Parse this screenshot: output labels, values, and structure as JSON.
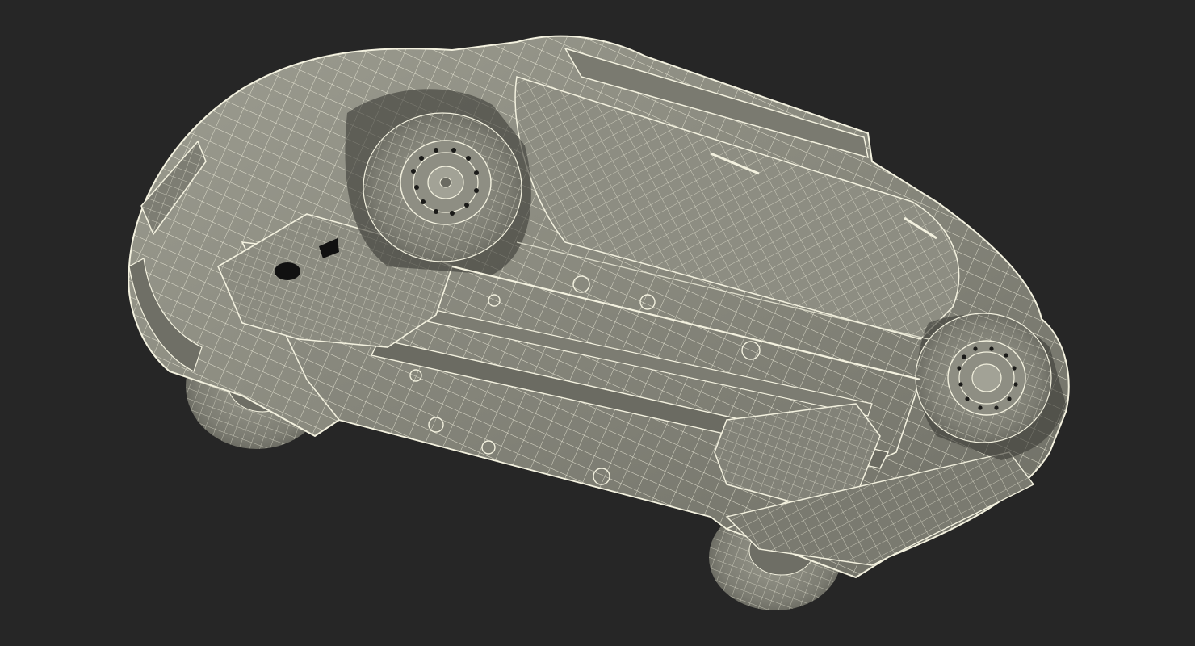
{
  "scene": {
    "subject": "car-underside-wireframe",
    "colors": {
      "background": "#262626",
      "surface": "#8a8a7e",
      "surface_light": "#a3a396",
      "surface_dark": "#5e5e55",
      "wire": "#f3f1df",
      "shadow": "#1d1d1b"
    }
  }
}
